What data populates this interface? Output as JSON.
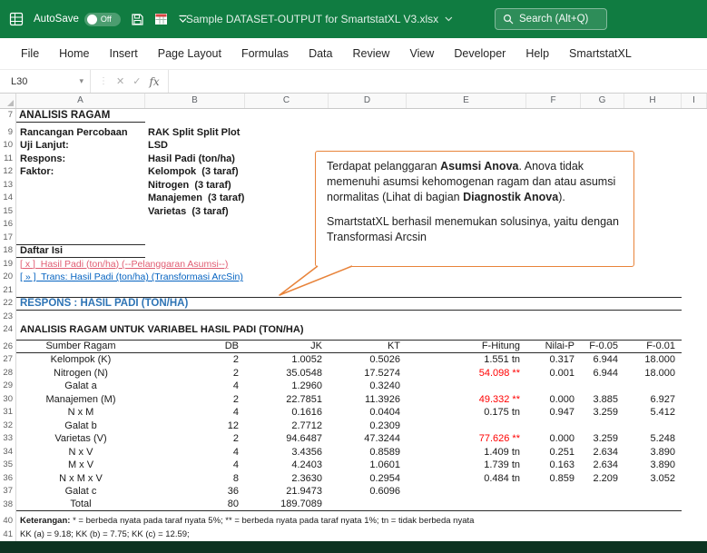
{
  "theme": {
    "titlebar_green": "#107C41",
    "callout_orange": "#E8833A",
    "link_blue": "#0563C1",
    "link_red": "#E05C72",
    "heading_blue": "#2E74B5",
    "significant_red": "#FF0000"
  },
  "titlebar": {
    "autosave_label": "AutoSave",
    "autosave_state": "Off",
    "filename": "Sample DATASET-OUTPUT for SmartstatXL V3.xlsx",
    "search_placeholder": "Search (Alt+Q)"
  },
  "menu": {
    "items": [
      "File",
      "Home",
      "Insert",
      "Page Layout",
      "Formulas",
      "Data",
      "Review",
      "View",
      "Developer",
      "Help",
      "SmartstatXL"
    ]
  },
  "formula_bar": {
    "cell_ref": "L30",
    "cancel_glyph": "✕",
    "enter_glyph": "✓",
    "fx_label": "fx",
    "formula_value": ""
  },
  "columns": [
    "A",
    "B",
    "C",
    "D",
    "E",
    "F",
    "G",
    "H",
    "I"
  ],
  "row_numbers": [
    {
      "n": "7"
    },
    {
      "cls": "collapsed"
    },
    {
      "n": "9"
    },
    {
      "n": "10"
    },
    {
      "n": "11"
    },
    {
      "n": "12"
    },
    {
      "n": "13"
    },
    {
      "n": "14"
    },
    {
      "n": "15"
    },
    {
      "n": "16"
    },
    {
      "n": "17"
    },
    {
      "n": "18"
    },
    {
      "n": "19"
    },
    {
      "n": "20"
    },
    {
      "n": "21"
    },
    {
      "n": "22"
    },
    {
      "n": "23"
    },
    {
      "n": "24"
    },
    {
      "cls": "collapsed"
    },
    {
      "n": "26"
    },
    {
      "n": "27"
    },
    {
      "n": "28"
    },
    {
      "n": "29"
    },
    {
      "n": "30"
    },
    {
      "n": "31"
    },
    {
      "n": "32"
    },
    {
      "n": "33"
    },
    {
      "n": "34"
    },
    {
      "n": "35"
    },
    {
      "n": "36"
    },
    {
      "n": "37"
    },
    {
      "n": "38"
    },
    {
      "cls": "collapsed"
    },
    {
      "n": "40"
    },
    {
      "n": "41"
    }
  ],
  "sheet": {
    "section_title": "ANALISIS RAGAM",
    "info": [
      {
        "label": "Rancangan Percobaan",
        "value": "RAK Split Split Plot"
      },
      {
        "label": "Uji Lanjut:",
        "value": "LSD"
      },
      {
        "label": "Respons:",
        "value": "Hasil Padi (ton/ha)"
      },
      {
        "label": "Faktor:",
        "value": "Kelompok  (3 taraf)"
      },
      {
        "label": "",
        "value": "Nitrogen  (3 taraf)"
      },
      {
        "label": "",
        "value": "Manajemen  (3 taraf)"
      },
      {
        "label": "",
        "value": "Varietas  (3 taraf)"
      }
    ],
    "toc_heading": "Daftar Isi",
    "toc_links": [
      {
        "text": "[ x ]  Hasil Padi (ton/ha) (--Pelanggaran Asumsi--)",
        "cls": "link-red"
      },
      {
        "text": "[ » ]  Trans: Hasil Padi (ton/ha) (Transformasi ArcSin)",
        "cls": "link-blue"
      }
    ],
    "respons_heading": "RESPONS : HASIL PADI (TON/HA)",
    "table_title": "ANALISIS RAGAM UNTUK VARIABEL HASIL PADI (TON/HA)",
    "anova_headers": [
      "Sumber Ragam",
      "DB",
      "JK",
      "KT",
      "F-Hitung",
      "Nilai-P",
      "F-0.05",
      "F-0.01"
    ],
    "anova_rows": [
      {
        "src": "Kelompok (K)",
        "db": "2",
        "jk": "1.0052",
        "kt": "0.5026",
        "f": "1.551 tn",
        "p": "0.317",
        "f05": "6.944",
        "f01": "18.000"
      },
      {
        "cls": "sig",
        "src": "Nitrogen (N)",
        "db": "2",
        "jk": "35.0548",
        "kt": "17.5274",
        "f": "54.098 **",
        "p": "0.001",
        "f05": "6.944",
        "f01": "18.000"
      },
      {
        "src": "Galat a",
        "db": "4",
        "jk": "1.2960",
        "kt": "0.3240",
        "f": "",
        "p": "",
        "f05": "",
        "f01": ""
      },
      {
        "cls": "sig",
        "src": "Manajemen (M)",
        "db": "2",
        "jk": "22.7851",
        "kt": "11.3926",
        "f": "49.332 **",
        "p": "0.000",
        "f05": "3.885",
        "f01": "6.927"
      },
      {
        "src": "N x M",
        "db": "4",
        "jk": "0.1616",
        "kt": "0.0404",
        "f": "0.175 tn",
        "p": "0.947",
        "f05": "3.259",
        "f01": "5.412"
      },
      {
        "src": "Galat b",
        "db": "12",
        "jk": "2.7712",
        "kt": "0.2309",
        "f": "",
        "p": "",
        "f05": "",
        "f01": ""
      },
      {
        "cls": "sig",
        "src": "Varietas (V)",
        "db": "2",
        "jk": "94.6487",
        "kt": "47.3244",
        "f": "77.626 **",
        "p": "0.000",
        "f05": "3.259",
        "f01": "5.248"
      },
      {
        "src": "N x V",
        "db": "4",
        "jk": "3.4356",
        "kt": "0.8589",
        "f": "1.409 tn",
        "p": "0.251",
        "f05": "2.634",
        "f01": "3.890"
      },
      {
        "src": "M x V",
        "db": "4",
        "jk": "4.2403",
        "kt": "1.0601",
        "f": "1.739 tn",
        "p": "0.163",
        "f05": "2.634",
        "f01": "3.890"
      },
      {
        "src": "N x M x V",
        "db": "8",
        "jk": "2.3630",
        "kt": "0.2954",
        "f": "0.484 tn",
        "p": "0.859",
        "f05": "2.209",
        "f01": "3.052"
      },
      {
        "src": "Galat c",
        "db": "36",
        "jk": "21.9473",
        "kt": "0.6096",
        "f": "",
        "p": "",
        "f05": "",
        "f01": ""
      },
      {
        "cls": "total",
        "src": "Total",
        "db": "80",
        "jk": "189.7089",
        "kt": "",
        "f": "",
        "p": "",
        "f05": "",
        "f01": ""
      }
    ],
    "keterangan_label": "Keterangan:",
    "keterangan_text": " * = berbeda nyata pada taraf nyata 5%; ** = berbeda nyata pada taraf nyata 1%; tn = tidak berbeda nyata",
    "kk_text": "KK (a) = 9.18; KK (b) = 7.75; KK (c) = 12.59;"
  },
  "callout": {
    "p1_parts": [
      "Terdapat pelanggaran ",
      "Asumsi Anova",
      ". Anova tidak memenuhi asumsi kehomogenan ragam dan atau asumsi normalitas (Lihat di bagian ",
      "Diagnostik Anova",
      ")."
    ],
    "p2": "SmartstatXL berhasil menemukan solusinya, yaitu dengan Transformasi Arcsin"
  }
}
